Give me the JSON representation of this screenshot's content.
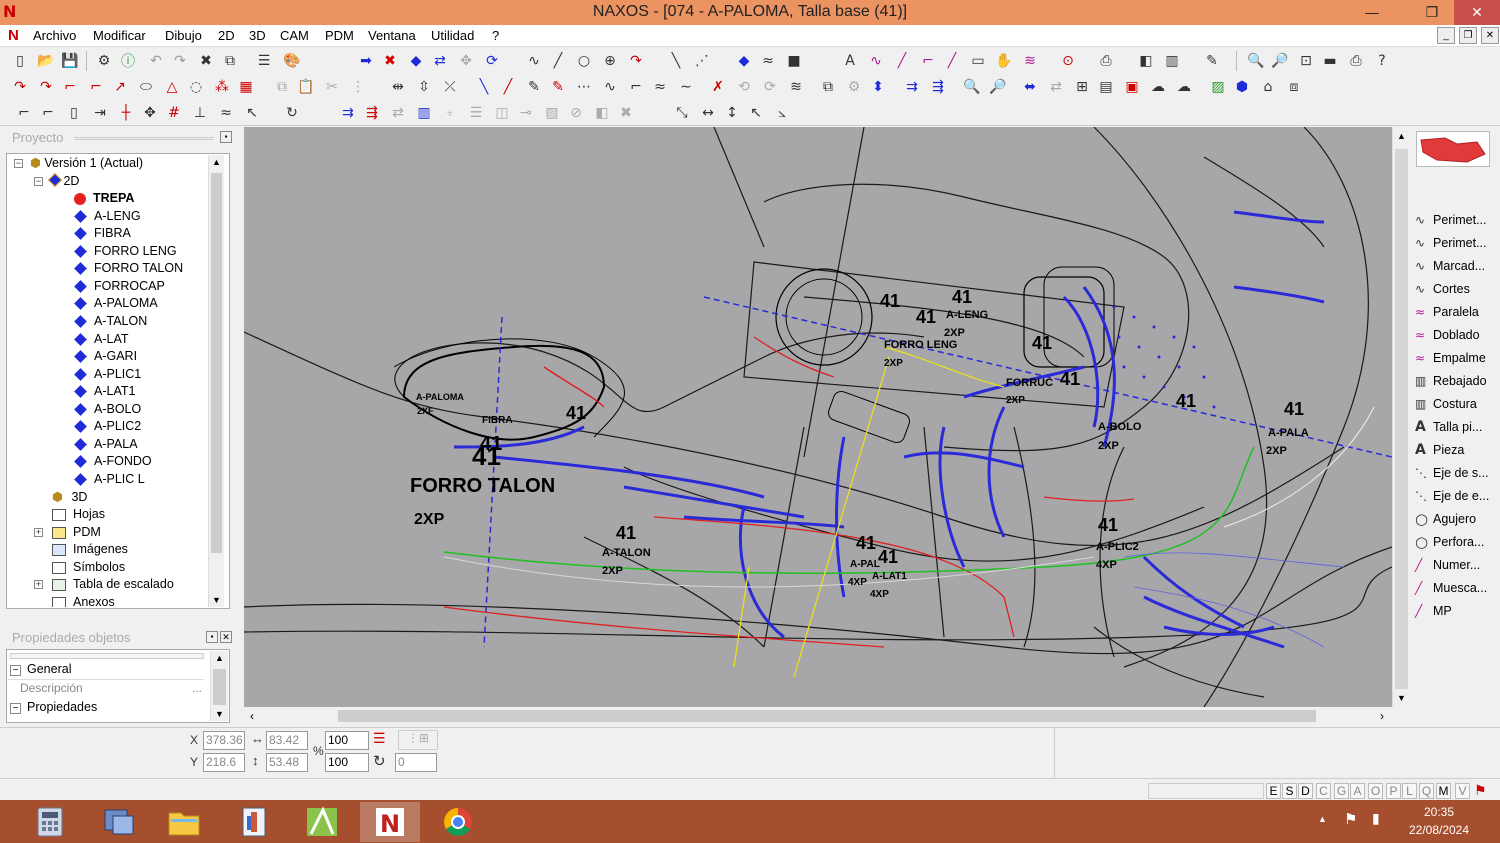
{
  "window": {
    "title": "NAXOS - [074 - A-PALOMA, Talla base (41)]",
    "minimize": "—",
    "maximize": "❐",
    "close": "✕"
  },
  "menu": [
    "Archivo",
    "Modificar",
    "Dibujo",
    "2D",
    "3D",
    "CAM",
    "PDM",
    "Ventana",
    "Utilidad",
    "?"
  ],
  "project_panel": {
    "title": "Proyecto",
    "version": "Versión 1 (Actual)",
    "folder_2d": "2D",
    "pieces": [
      "TREPA",
      "A-LENG",
      "FIBRA",
      "FORRO LENG",
      "FORRO TALON",
      "FORROCAP",
      "A-PALOMA",
      "A-TALON",
      "A-LAT",
      "A-GARI",
      "A-PLIC1",
      "A-LAT1",
      "A-BOLO",
      "A-PLIC2",
      "A-PALA",
      "A-FONDO",
      "A-PLIC L"
    ],
    "other_nodes": [
      "3D",
      "Hojas",
      "PDM",
      "Imágenes",
      "Símbolos",
      "Tabla de escalado",
      "Anexos"
    ]
  },
  "properties_panel": {
    "title": "Propiedades objetos",
    "general": "General",
    "descripcion": "Descripción",
    "descripcion_btn": "...",
    "propiedades": "Propiedades"
  },
  "canvas_labels": {
    "talla": "41",
    "a_paloma": "A-PALOMA",
    "qty_2xf": "2XF",
    "fibra": "FIBRA",
    "forro_talon": "FORRO TALON",
    "qty_2xp": "2XP",
    "a_talon": "A-TALON",
    "a_leng": "A-LENG",
    "forro_leng": "FORRO LENG",
    "forrocap": "FORRUC",
    "a_bolo": "A-BOLO",
    "a_pala": "A-PALA",
    "a_plic2": "A-PLIC2",
    "qty_4xp": "4XP",
    "a_lat": "A-LAT",
    "a_lat1": "A-LAT1",
    "a_pall": "A-PAL",
    "a_leng_small": "A-LENG",
    "qty_4xp_b": "4XP",
    "qty_2xp_leng": "2XP"
  },
  "right_tools": [
    "Perimet...",
    "Perimet...",
    "Marcad...",
    "Cortes",
    "Paralela",
    "Doblado",
    "Empalme",
    "Rebajado",
    "Costura",
    "Talla pi...",
    "Pieza",
    "Eje de s...",
    "Eje de e...",
    "Agujero",
    "Perfora...",
    "Numer...",
    "Muesca...",
    "MP"
  ],
  "coords": {
    "x_label": "X",
    "y_label": "Y",
    "x": "378.36",
    "y": "218.6",
    "w": "83.42",
    "h": "53.48",
    "pct_label": "%",
    "scale_x": "100",
    "scale_y": "100",
    "angle": "0"
  },
  "status_letters": [
    "E",
    "S",
    "D",
    "C",
    "G",
    "A",
    "O",
    "P",
    "L",
    "Q",
    "M",
    "V"
  ],
  "tray": {
    "time": "20:35",
    "date": "22/08/2024",
    "up_arrow": "▲",
    "flag": "⚑",
    "signal": "▮"
  },
  "colors": {
    "titlebar": "#eb9461",
    "taskbar": "#a54f2e",
    "canvas": "#a7a7a9",
    "piece_diamond": "#1e2bd8",
    "active_dot": "#e52020"
  }
}
